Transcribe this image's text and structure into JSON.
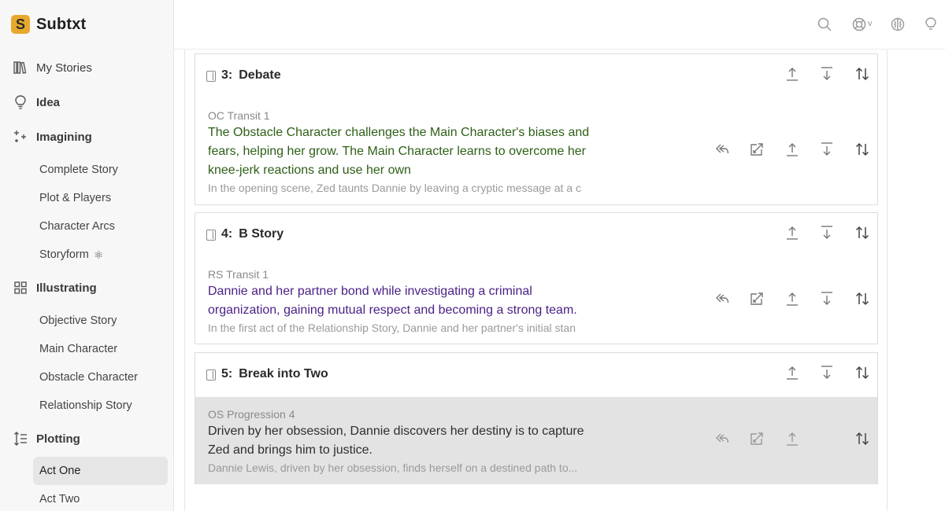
{
  "app": {
    "name": "Subtxt",
    "logo_letter": "S"
  },
  "sidebar": {
    "items": [
      {
        "label": "My Stories",
        "icon": "library-icon"
      },
      {
        "label": "Idea",
        "icon": "lightbulb-icon"
      },
      {
        "label": "Imagining",
        "icon": "sparkle-icon"
      },
      {
        "label": "Illustrating",
        "icon": "grid-icon"
      },
      {
        "label": "Plotting",
        "icon": "list-order-icon"
      }
    ],
    "imagining_sub": [
      "Complete Story",
      "Plot & Players",
      "Character Arcs",
      "Storyform"
    ],
    "illustrating_sub": [
      "Objective Story",
      "Main Character",
      "Obstacle Character",
      "Relationship Story"
    ],
    "plotting_sub": [
      "Act One",
      "Act Two"
    ],
    "active": "Act One"
  },
  "topbar": {
    "icons": [
      "search-icon",
      "lifebuoy-icon",
      "brain-icon",
      "lightbulb-icon"
    ],
    "caret": "v"
  },
  "cards": [
    {
      "number": "3:",
      "title": "Debate",
      "beat": {
        "label": "OC Transit 1",
        "text": "The Obstacle Character challenges the Main Character's biases and fears, helping her grow. The Main Character learns to overcome her knee-jerk reactions and use her own",
        "sub": "In the opening scene, Zed taunts Dannie by leaving a cryptic message at a c"
      }
    },
    {
      "number": "4:",
      "title": "B Story",
      "beat": {
        "label": "RS Transit 1",
        "text": "Dannie and her partner bond while investigating a criminal organization, gaining mutual respect and becoming a strong team.",
        "sub": "In the first act of the Relationship Story, Dannie and her partner's initial stan"
      }
    },
    {
      "number": "5:",
      "title": "Break into Two",
      "beat": {
        "label": "OS Progression 4",
        "text": "Driven by her obsession, Dannie discovers her destiny is to capture Zed and brings him to justice.",
        "sub": "Dannie Lewis, driven by her obsession, finds herself on a destined path to..."
      }
    }
  ],
  "colors": {
    "logo": "#e8a82e",
    "oc_text": "#2d5f16",
    "rs_text": "#4a1f86",
    "active_beat_bg": "#e3e3e3"
  }
}
